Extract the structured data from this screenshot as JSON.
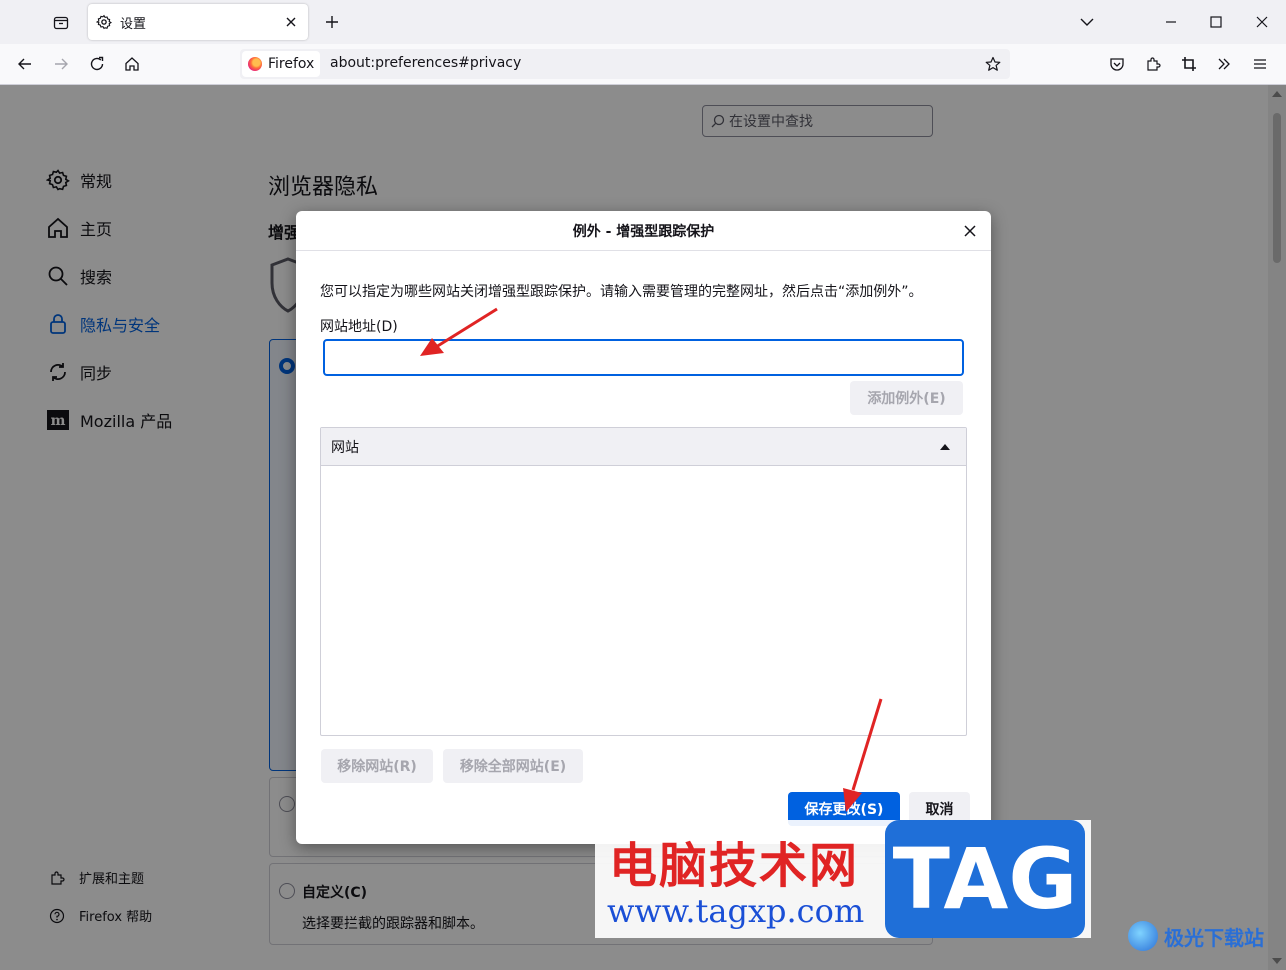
{
  "tab": {
    "title": "设置"
  },
  "urlbar": {
    "identity": "Firefox",
    "url": "about:preferences#privacy"
  },
  "search": {
    "placeholder": "在设置中查找"
  },
  "sidebar": {
    "items": [
      {
        "label": "常规",
        "icon": "gear-icon"
      },
      {
        "label": "主页",
        "icon": "home-icon"
      },
      {
        "label": "搜索",
        "icon": "search-icon"
      },
      {
        "label": "隐私与安全",
        "icon": "lock-icon",
        "selected": true
      },
      {
        "label": "同步",
        "icon": "sync-icon"
      },
      {
        "label": "Mozilla 产品",
        "icon": "mozilla-icon"
      }
    ],
    "footer": [
      {
        "label": "扩展和主题",
        "icon": "puzzle-icon"
      },
      {
        "label": "Firefox 帮助",
        "icon": "help-icon"
      }
    ]
  },
  "pane": {
    "title": "浏览器隐私",
    "subtitle": "增强",
    "custom_option": {
      "title": "自定义(C)",
      "desc": "选择要拦截的跟踪器和脚本。"
    }
  },
  "dialog": {
    "title": "例外 - 增强型跟踪保护",
    "description": "您可以指定为哪些网站关闭增强型跟踪保护。请输入需要管理的完整网址，然后点击“添加例外”。",
    "address_label": "网站地址(D)",
    "address_value": "",
    "add_button": "添加例外(E)",
    "list_header": "网站",
    "remove_button": "移除网站(R)",
    "remove_all_button": "移除全部网站(E)",
    "save_button": "保存更改(S)",
    "cancel_button": "取消"
  },
  "watermark": {
    "cn_text": "电脑技术网",
    "url_text": "www.tagxp.com",
    "tag_text": "TAG",
    "site_text": "极光下载站"
  },
  "colors": {
    "accent": "#0061e0",
    "arrow": "#e02424"
  }
}
